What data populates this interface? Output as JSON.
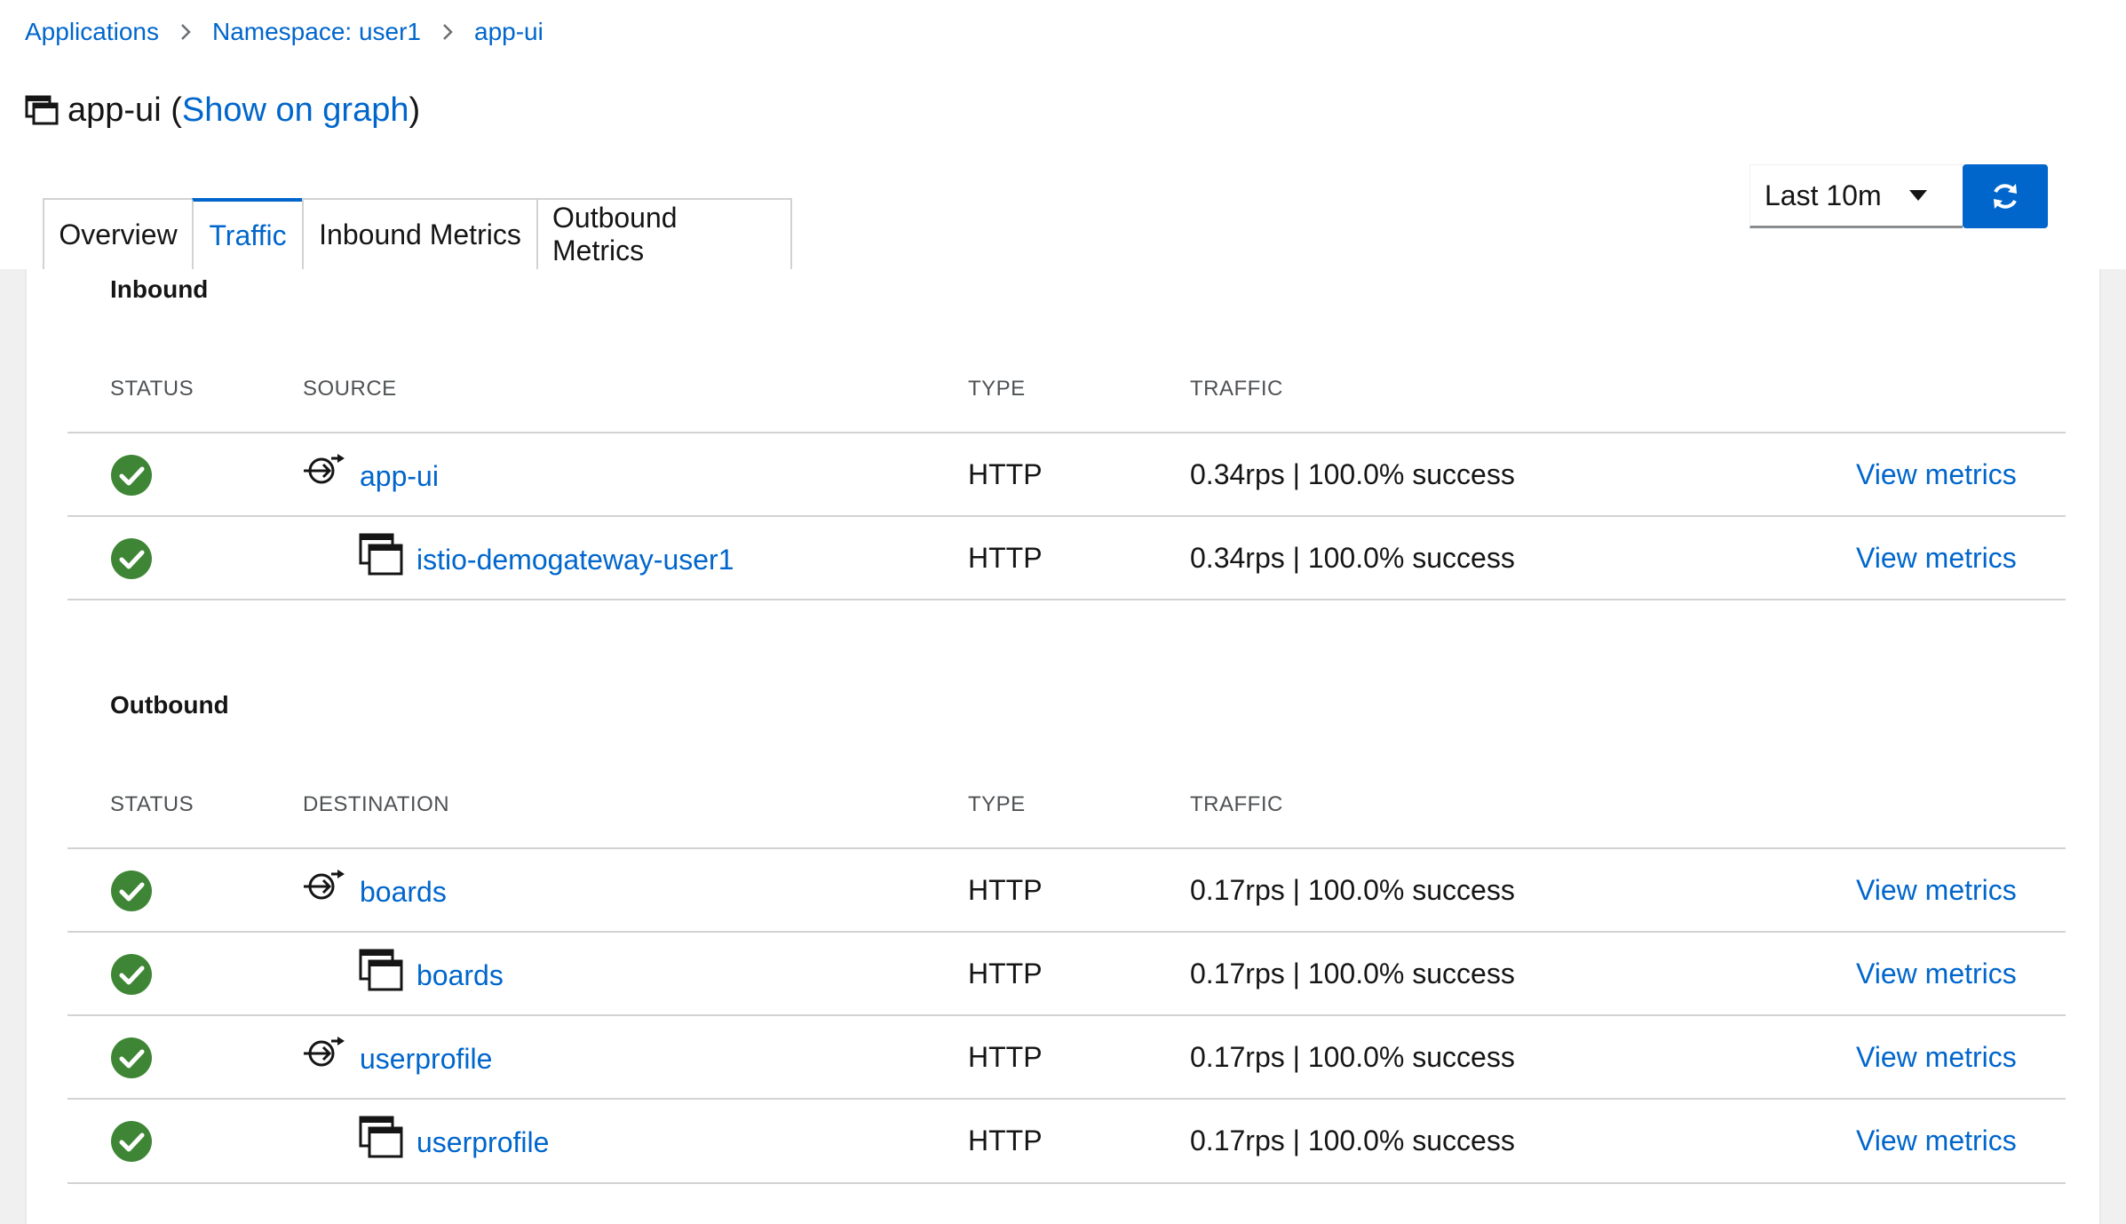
{
  "breadcrumb": {
    "items": [
      "Applications",
      "Namespace: user1",
      "app-ui"
    ]
  },
  "title": {
    "name": "app-ui",
    "open_paren": "(",
    "graph_link": "Show on graph",
    "close_paren": ")"
  },
  "tabs": [
    {
      "label": "Overview",
      "active": false
    },
    {
      "label": "Traffic",
      "active": true
    },
    {
      "label": "Inbound Metrics",
      "active": false
    },
    {
      "label": "Outbound Metrics",
      "active": false
    }
  ],
  "controls": {
    "time_range": "Last 10m"
  },
  "inbound": {
    "title": "Inbound",
    "headers": {
      "status": "STATUS",
      "node": "SOURCE",
      "type": "TYPE",
      "traffic": "TRAFFIC"
    },
    "rows": [
      {
        "node_kind": "service",
        "name": "app-ui",
        "type": "HTTP",
        "traffic": "0.34rps | 100.0% success",
        "action": "View metrics"
      },
      {
        "node_kind": "workload",
        "name": "istio-demogateway-user1",
        "type": "HTTP",
        "traffic": "0.34rps | 100.0% success",
        "action": "View metrics"
      }
    ]
  },
  "outbound": {
    "title": "Outbound",
    "headers": {
      "status": "STATUS",
      "node": "DESTINATION",
      "type": "TYPE",
      "traffic": "TRAFFIC"
    },
    "rows": [
      {
        "node_kind": "service",
        "name": "boards",
        "type": "HTTP",
        "traffic": "0.17rps | 100.0% success",
        "action": "View metrics"
      },
      {
        "node_kind": "workload",
        "name": "boards",
        "type": "HTTP",
        "traffic": "0.17rps | 100.0% success",
        "action": "View metrics"
      },
      {
        "node_kind": "service",
        "name": "userprofile",
        "type": "HTTP",
        "traffic": "0.17rps | 100.0% success",
        "action": "View metrics"
      },
      {
        "node_kind": "workload",
        "name": "userprofile",
        "type": "HTTP",
        "traffic": "0.17rps | 100.0% success",
        "action": "View metrics"
      }
    ]
  },
  "colors": {
    "link": "#0066cc",
    "success": "#3e8635",
    "primary_button": "#0066cc"
  },
  "icons": {
    "status": "check-circle-icon",
    "service": "service-icon",
    "workload": "workload-icon",
    "app": "application-icon",
    "refresh": "refresh-icon",
    "separator": "chevron-right-icon",
    "dropdown": "caret-down-icon"
  }
}
